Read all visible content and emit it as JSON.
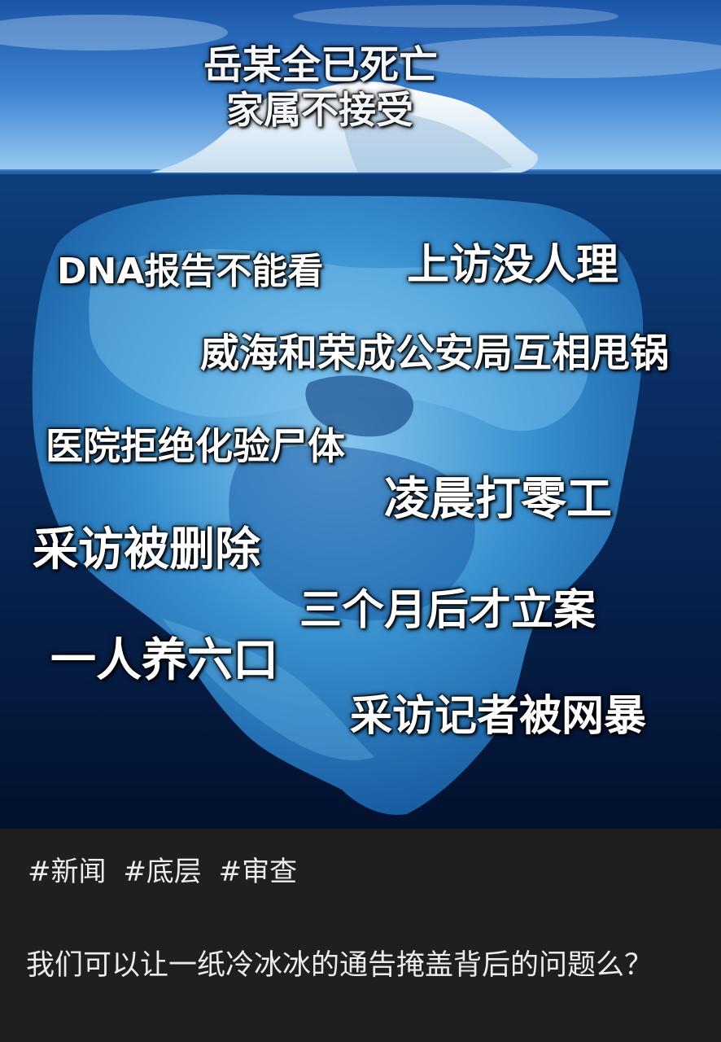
{
  "iceberg": {
    "tip_lines": [
      "岳某全已死亡",
      "家属不接受"
    ],
    "underwater_labels": [
      "DNA报告不能看",
      "上访没人理",
      "威海和荣成公安局互相甩锅",
      "医院拒绝化验尸体",
      "凌晨打零工",
      "采访被删除",
      "三个月后才立案",
      "一人养六口",
      "采访记者被网暴"
    ]
  },
  "post": {
    "tags": [
      "#新闻",
      "#底层",
      "#审查"
    ],
    "text": "我们可以让一纸冷冰冰的通告掩盖背后的问题么？"
  },
  "colors": {
    "sky_top": "#1d5fb8",
    "sky_horizon": "#8fc4ef",
    "deep_water": "#031638",
    "ice_underwater": "#3f9bd8",
    "caption_bg": "#1f1f1f",
    "caption_text": "#ececec"
  }
}
